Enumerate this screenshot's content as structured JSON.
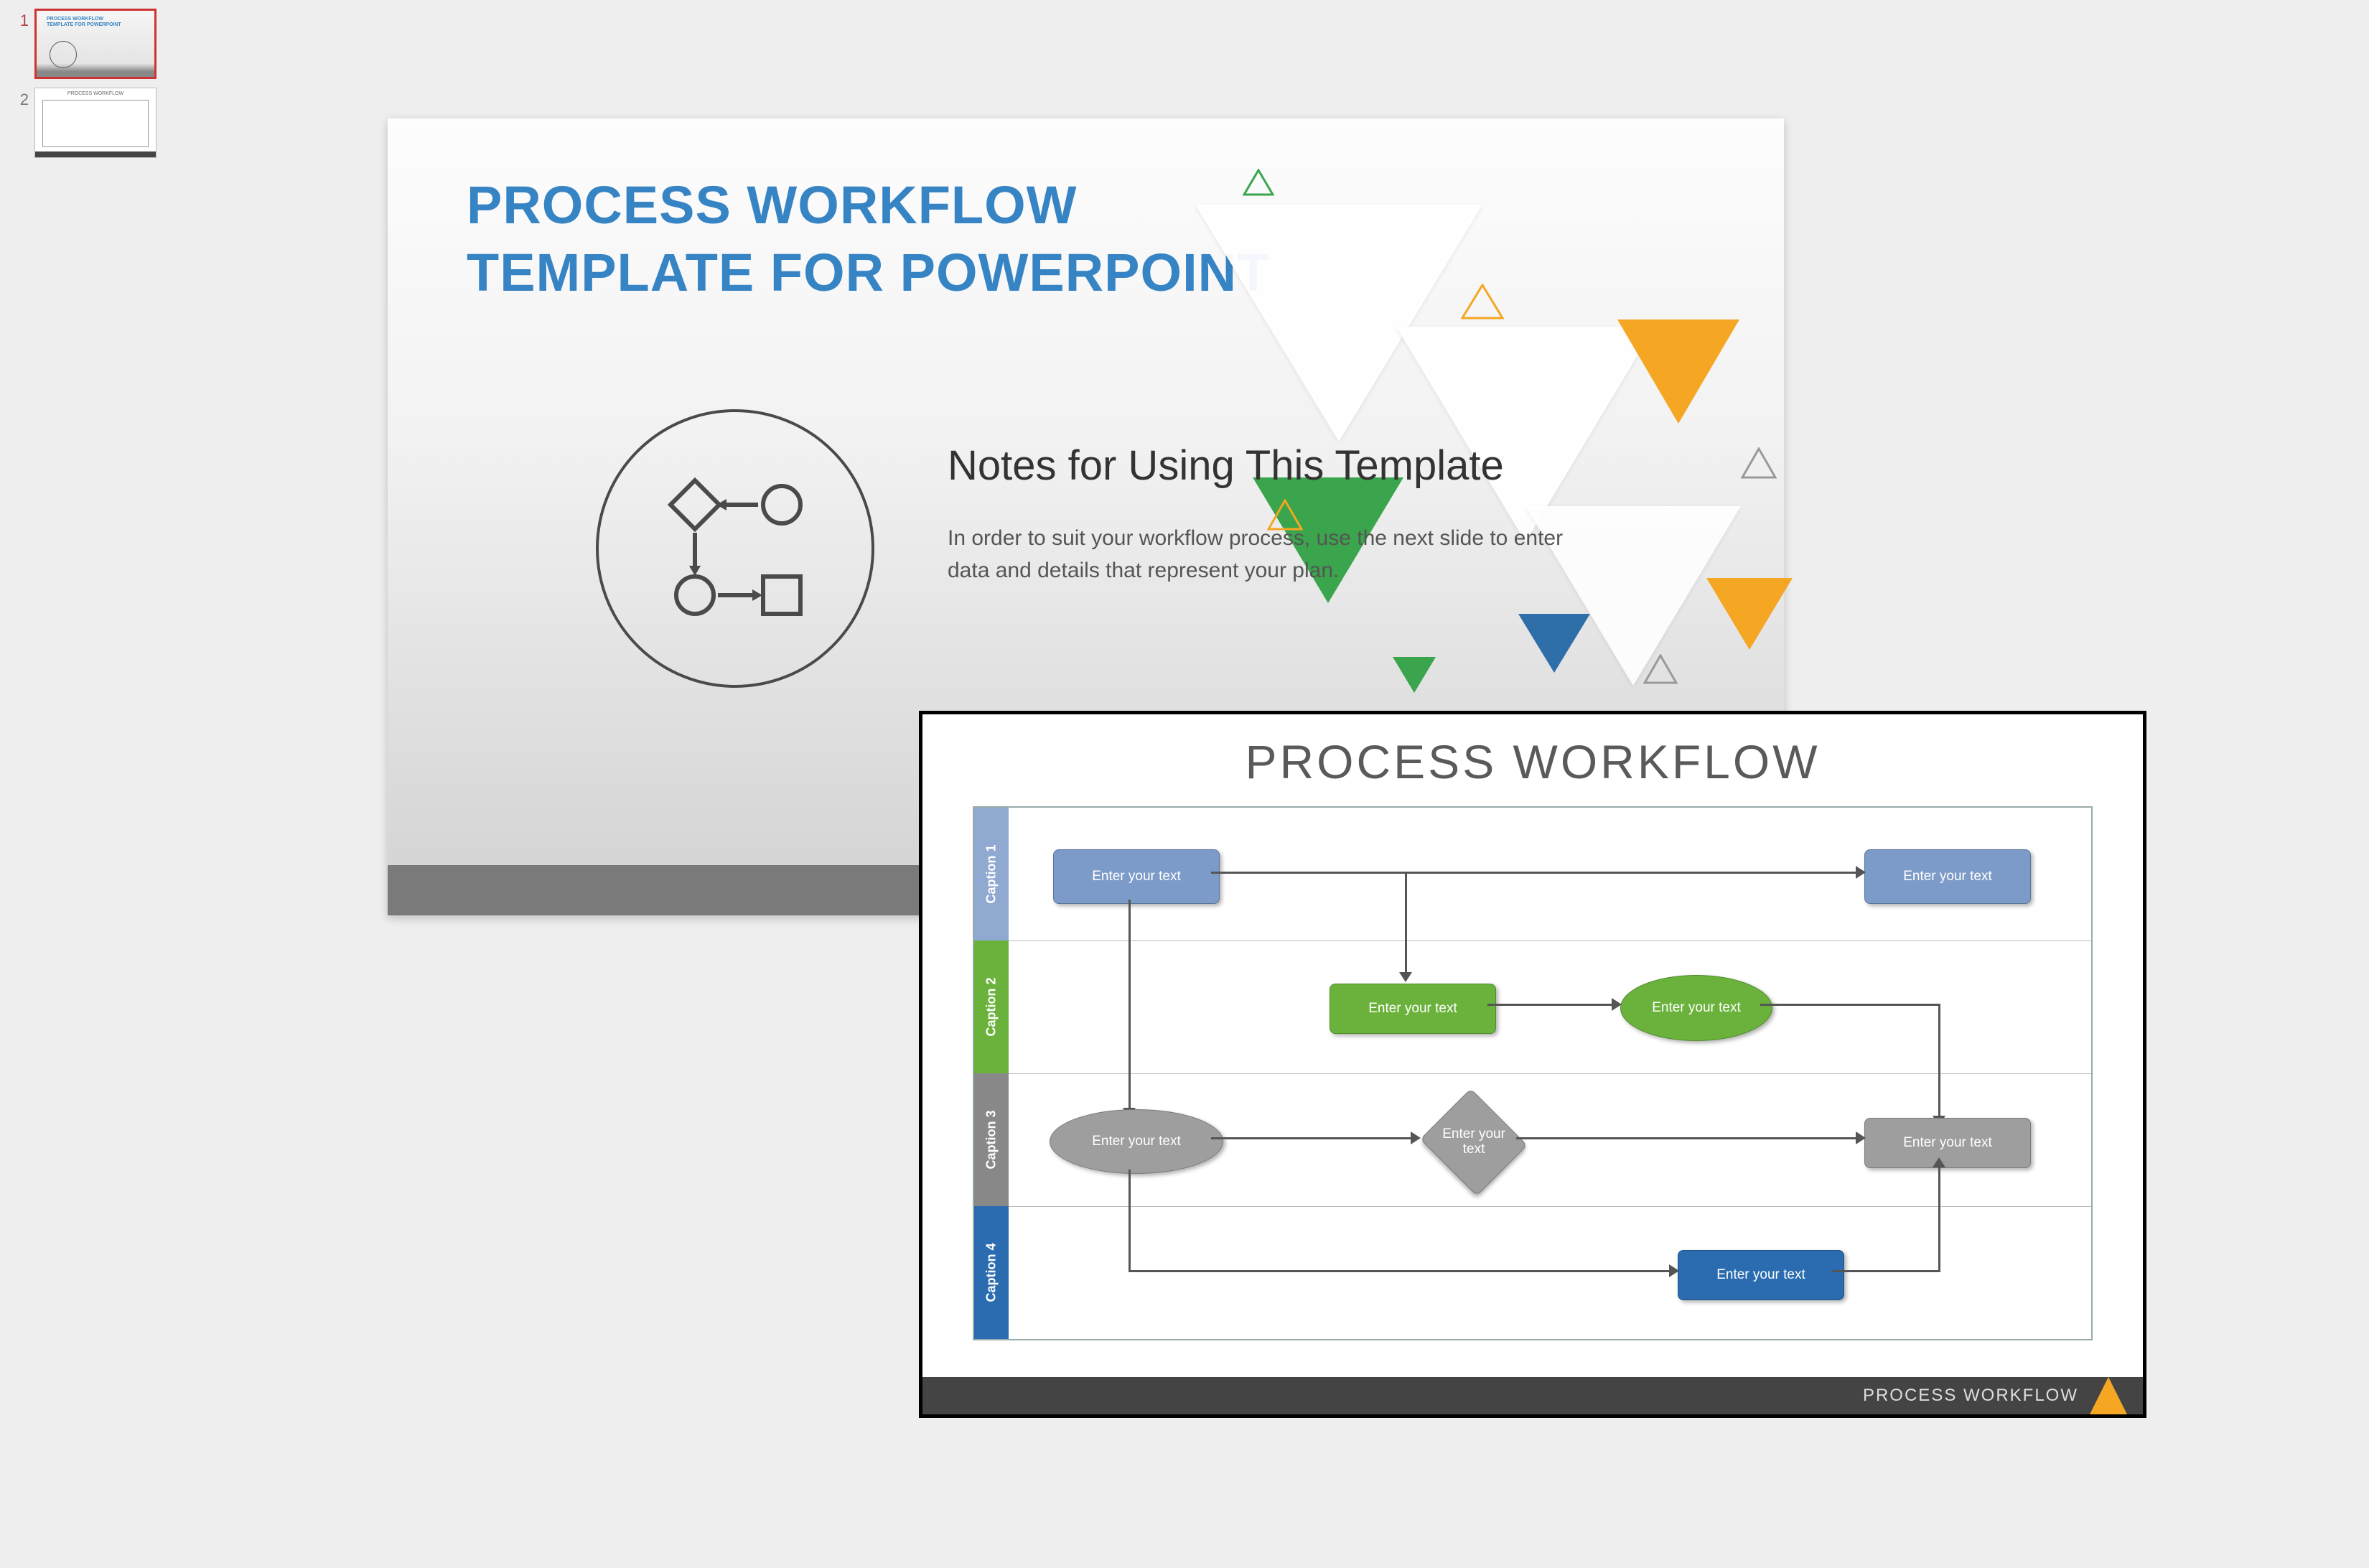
{
  "thumbs": {
    "slide1_number": "1",
    "slide2_number": "2",
    "slide2_title": "PROCESS WORKFLOW"
  },
  "main_slide": {
    "title_line1": "PROCESS WORKFLOW",
    "title_line2": "TEMPLATE FOR POWERPOINT",
    "notes_heading": "Notes for Using This Template",
    "notes_body": "In order to suit your workflow process, use the next slide to enter data and details that represent your plan."
  },
  "preview": {
    "title": "PROCESS WORKFLOW",
    "footer": "PROCESS WORKFLOW",
    "lanes": {
      "caption1": "Caption 1",
      "caption2": "Caption 2",
      "caption3": "Caption 3",
      "caption4": "Caption 4"
    },
    "nodes": {
      "n1": "Enter your text",
      "n2": "Enter your text",
      "n3": "Enter your text",
      "n4": "Enter\nyour text",
      "n5": "Enter your text",
      "n6": "Enter your\ntext",
      "n7": "Enter your text",
      "n8": "Enter your text"
    }
  }
}
